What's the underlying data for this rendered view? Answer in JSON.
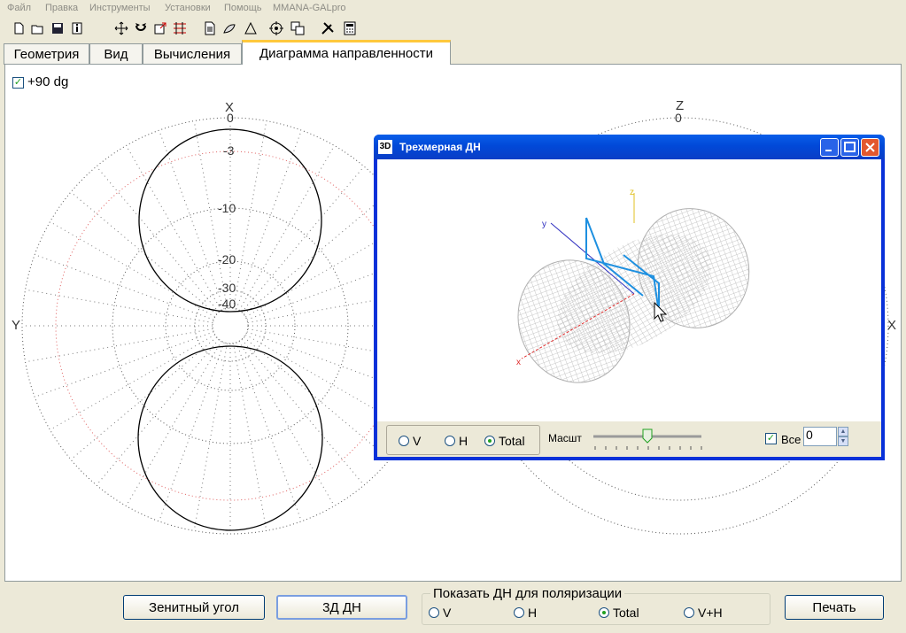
{
  "menu": [
    "Файл",
    "Правка",
    "Инструменты",
    "Установки",
    "Помощь",
    "MMANA-GALpro"
  ],
  "toolbar_icons": [
    "new-file-icon",
    "open-folder-icon",
    "save-icon",
    "info-icon",
    "move-icon",
    "rotate-icon",
    "export-icon",
    "wire-edit-icon",
    "document-icon",
    "paint-icon",
    "triangle-icon",
    "target-icon",
    "copy-icon",
    "tools-icon",
    "calculator-icon"
  ],
  "tabs": [
    "Геометрия",
    "Вид",
    "Вычисления",
    "Диаграмма направленности"
  ],
  "active_tab": 3,
  "panel": {
    "checkbox_label": "+90 dg",
    "checkbox_checked": true,
    "left_plot": {
      "axis_top": "X",
      "axis_left": "Y",
      "ring_labels": [
        "0",
        "-3",
        "-10",
        "-20",
        "-30",
        "-40"
      ]
    },
    "right_plot": {
      "axis_top": "Z",
      "ring_label_top": "0",
      "axis_right": "X"
    }
  },
  "window_3d": {
    "icon_text": "3D",
    "title": "Трехмерная ДН",
    "axis_labels": {
      "z": "z",
      "y": "y",
      "x": "x"
    },
    "polarization_options": [
      "V",
      "H",
      "Total"
    ],
    "selected_polarization": "Total",
    "scale_label": "Масшт",
    "scale_level": 0.5,
    "all_label": "Все",
    "all_checked": true,
    "all_value": "0",
    "colors": {
      "mesh": "#c0c0c0",
      "x_axis": "#e03030",
      "y_axis": "#3030c0",
      "z_axis": "#e0c020",
      "wire": "#1e90e0"
    }
  },
  "bottom": {
    "zenith_button": "Зенитный угол",
    "three_d_button": "3Д   ДН",
    "group_title": "Показать ДН для поляризации",
    "options": [
      "V",
      "H",
      "Total",
      "V+H"
    ],
    "selected": "Total",
    "print_button": "Печать"
  }
}
